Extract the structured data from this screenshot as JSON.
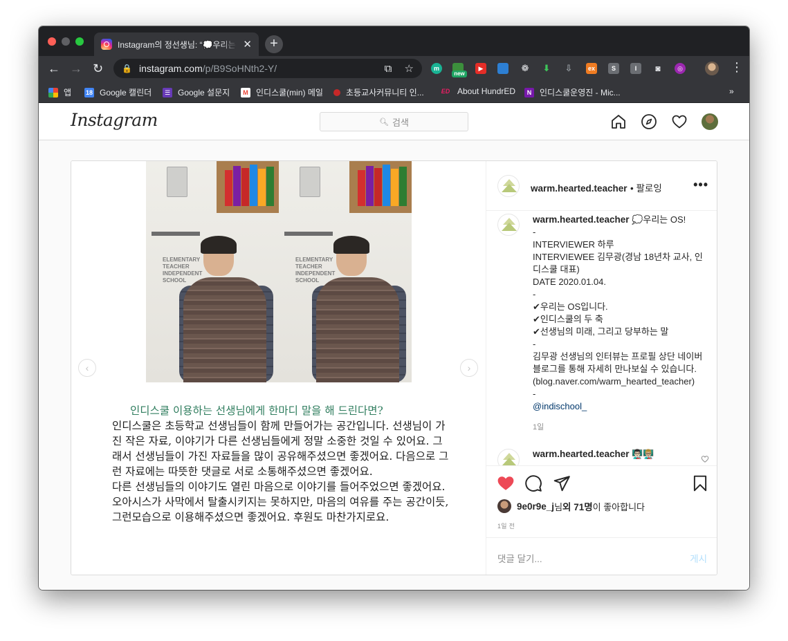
{
  "browser": {
    "tab_title": "Instagram의 정선생님: “💭우리는 OS",
    "tab_close": "✕",
    "new_tab": "+",
    "url_host": "instagram.com",
    "url_path": "/p/B9SoHNth2-Y/",
    "bookmarks": [
      {
        "label": "앱",
        "icon": "apps-grid-icon"
      },
      {
        "label": "Google 캘린더",
        "icon": "calendar-icon"
      },
      {
        "label": "Google 설문지",
        "icon": "forms-icon"
      },
      {
        "label": "인디스쿨(min) 메일",
        "icon": "gmail-icon"
      },
      {
        "label": "초등교사커뮤니티 인...",
        "icon": "community-icon"
      },
      {
        "label": "About HundrED",
        "icon": "hundred-icon"
      },
      {
        "label": "인디스쿨운영진 - Mic...",
        "icon": "onenote-icon"
      }
    ],
    "bookmarks_overflow": "»",
    "ext_new_badge": "new"
  },
  "instagram": {
    "logo": "Instagram",
    "search_placeholder": "검색"
  },
  "post": {
    "image_caption_question": "인디스쿨 이용하는 선생님에게 한마디 말을 해 드린다면?",
    "image_caption_body": "인디스쿨은 초등학교 선생님들이 함께 만들어가는 공간입니다. 선생님이 가진 작은 자료, 이야기가 다른 선생님들에게 정말 소중한 것일 수 있어요. 그래서 선생님들이 가진 자료들을 많이 공유해주셨으면 좋겠어요. 다음으로 그런 자료에는 따뜻한 댓글로 서로 소통해주셨으면 좋겠어요.\n다른 선생님들의 이야기도 열린 마음으로 이야기를 들어주었으면 좋겠어요. 오아시스가 사막에서 탈출시키지는 못하지만, 마음의 여유를 주는 공간이듯, 그런모습으로 이용해주셨으면 좋겠어요. 후원도 마찬가지로요.",
    "sign_text": "ELEMENTARY TEACHER INDEPENDENT SCHOOL",
    "author": "warm.hearted.teacher",
    "follow_text": "• 팔로잉",
    "more": "•••",
    "caption_head": "💭우리는 OS!",
    "caption_body": "-\nINTERVIEWER 하루\nINTERVIEWEE 김무광(경남 18년차 교사, 인디스쿨 대표)\nDATE 2020.01.04.\n-\n✔우리는 OS입니다.\n✔인디스쿨의 두 축\n✔선생님의 미래, 그리고 당부하는 말\n-\n김무광 선생님의 인터뷰는 프로필 상단 네이버 블로그를 통해 자세히 만나보실 수 있습니다.\n(blog.naver.com/warm_hearted_teacher)\n-",
    "caption_mention": "@indischool_",
    "caption_time": "1일",
    "reply_author": "warm.hearted.teacher",
    "reply_emoji": "👨🏻‍🏫👨🏼‍🏫",
    "likes_user": "9e0r9e_j",
    "likes_mid": "님 ",
    "likes_count": "외 71명",
    "likes_tail": "이 좋아합니다",
    "post_time": "1일 전",
    "comment_placeholder": "댓글 달기...",
    "post_button": "게시"
  },
  "colors": {
    "like_red": "#ed4956",
    "link_blue": "#00376b",
    "caption_green": "#2f7d5e"
  }
}
